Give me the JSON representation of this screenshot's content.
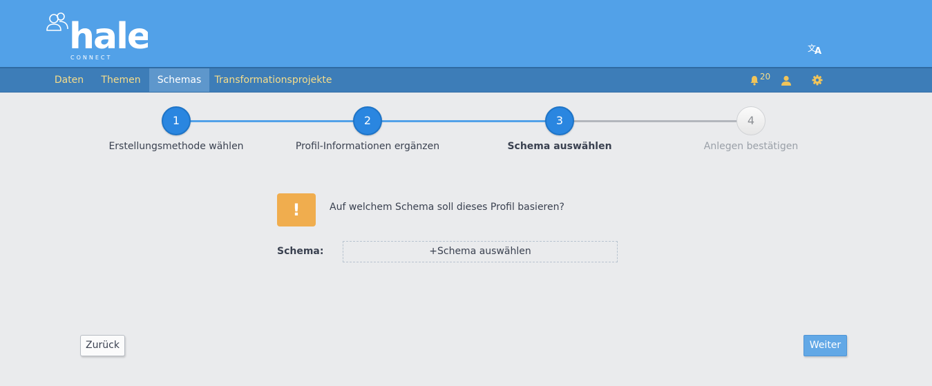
{
  "brand": {
    "logo_word": "hale",
    "logo_sub": "CONNECT"
  },
  "nav": {
    "items": [
      "Daten",
      "Themen",
      "Schemas",
      "Transformationsprojekte"
    ],
    "active": "Schemas",
    "notification_count": "20"
  },
  "stepper": {
    "steps": [
      {
        "number": "1",
        "label": "Erstellungsmethode wählen",
        "state": "done"
      },
      {
        "number": "2",
        "label": "Profil-Informationen ergänzen",
        "state": "done"
      },
      {
        "number": "3",
        "label": "Schema auswählen",
        "state": "current"
      },
      {
        "number": "4",
        "label": "Anlegen bestätigen",
        "state": "todo"
      }
    ]
  },
  "content": {
    "warning_symbol": "!",
    "question": "Auf welchem Schema soll dieses Profil basieren?",
    "schema_label": "Schema:",
    "schema_select_label": "+Schema auswählen"
  },
  "buttons": {
    "back": "Zurück",
    "next": "Weiter"
  },
  "colors": {
    "header": "#52a1e8",
    "navbar": "#3d7db8",
    "nav_text": "#f6dd8a",
    "step_active": "#2a86e0",
    "warning": "#f0ad4e"
  },
  "icons": {
    "logo": "people-icon",
    "translate": "translate-icon",
    "notifications": "bell-icon",
    "user": "user-icon",
    "settings": "gear-icon"
  }
}
